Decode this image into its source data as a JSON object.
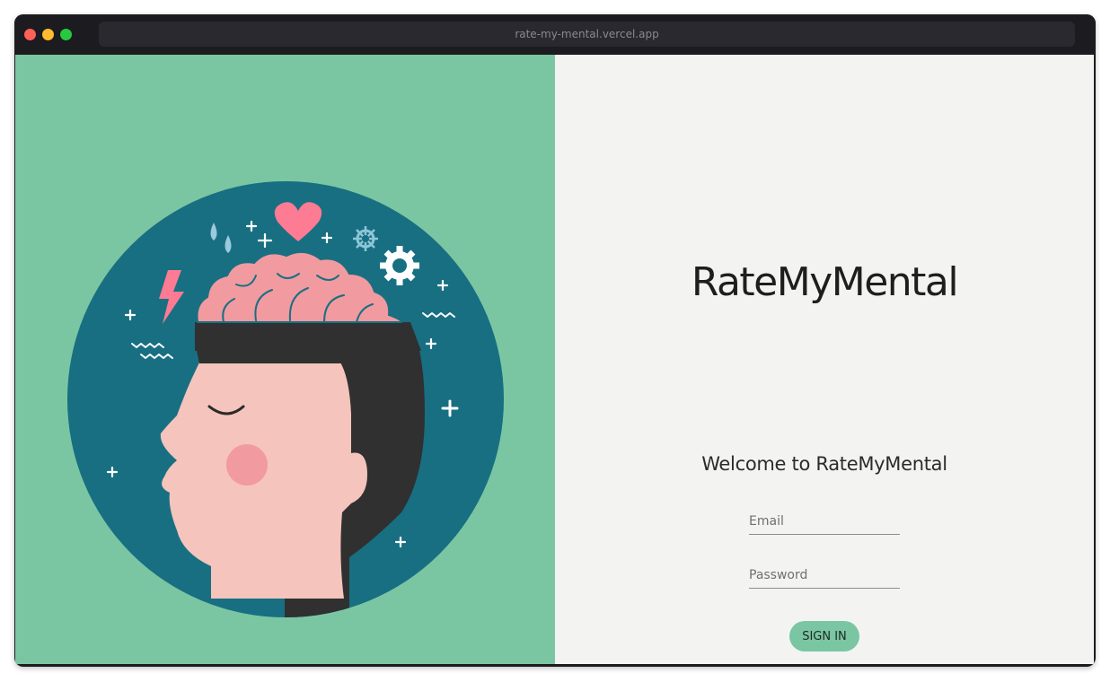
{
  "browser": {
    "url": "rate-my-mental.vercel.app"
  },
  "brand": {
    "title": "RateMyMental"
  },
  "login": {
    "welcome": "Welcome to RateMyMental",
    "email_placeholder": "Email",
    "password_placeholder": "Password",
    "signin_label": "SIGN IN"
  },
  "illustration": {
    "name": "head-with-brain-illustration"
  },
  "colors": {
    "accent_green": "#7bc6a2",
    "circle_teal": "#186f82",
    "brain_pink": "#f19aa0",
    "heart_pink": "#fd7b93",
    "skin": "#f5c4bc",
    "hair": "#303030",
    "right_bg": "#f3f4f2",
    "chrome_dark": "#1c1b20"
  }
}
